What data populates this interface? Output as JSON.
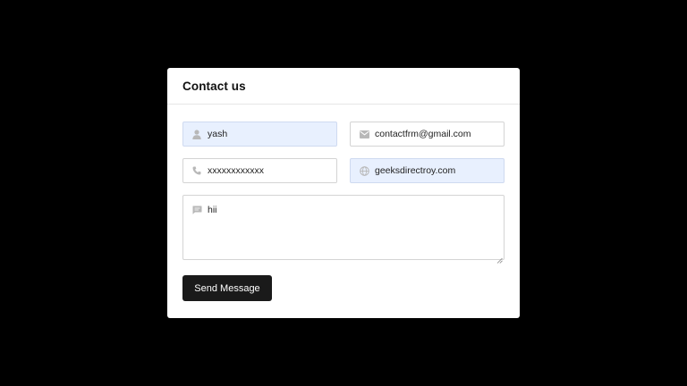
{
  "form": {
    "title": "Contact us",
    "name": {
      "value": "yash",
      "icon": "user-icon"
    },
    "email": {
      "value": "contactfrm@gmail.com",
      "icon": "envelope-icon"
    },
    "phone": {
      "value": "xxxxxxxxxxxx",
      "icon": "phone-icon"
    },
    "website": {
      "value": "geeksdirectroy.com",
      "icon": "globe-icon"
    },
    "message": {
      "value": "hii",
      "icon": "chat-icon"
    },
    "submit_label": "Send Message"
  },
  "colors": {
    "page_background": "#000000",
    "card_background": "#ffffff",
    "autofill_background": "#e8f0fe",
    "button_background": "#1a1a1a",
    "icon_color": "#b8b8b8"
  }
}
